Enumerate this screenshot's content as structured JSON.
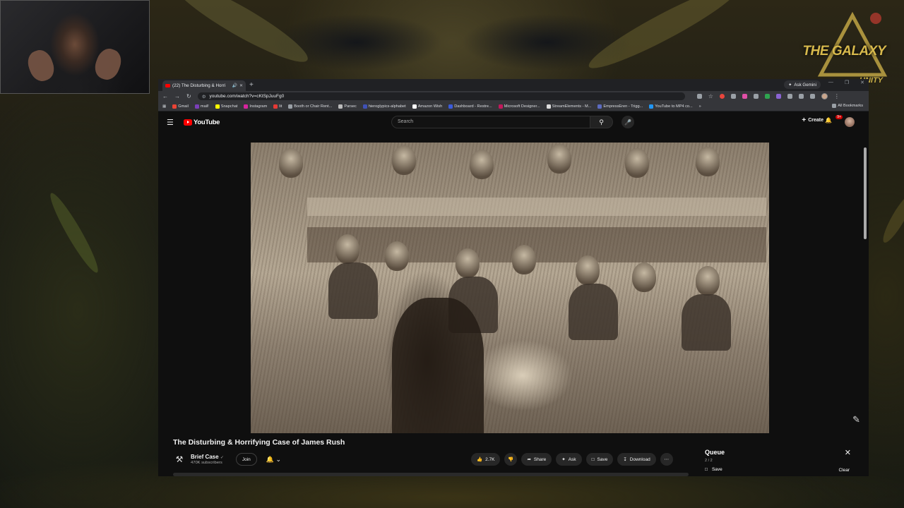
{
  "overlay": {
    "logo_text": "THE GALAXY",
    "logo_sub": "UNITY"
  },
  "browser": {
    "tab_title": "(22) The Disturbing & Horri",
    "gemini_label": "Ask Gemini",
    "url": "youtube.com/watch?v=cKtSpJuuFg0",
    "bookmarks": [
      "Gmail",
      "mail!",
      "Snapchat",
      "Instagram",
      "lit",
      "Booth or Chair Rent...",
      "Parsec",
      "hieroglypics-alphabet",
      "Amazon Wish",
      "Dashboard - Restre...",
      "Microsoft Designer...",
      "StreamElements - M...",
      "EmpressEren - Trigg...",
      "YouTube to MP4 co..."
    ],
    "all_bookmarks": "All Bookmarks"
  },
  "youtube": {
    "logo": "YouTube",
    "search_placeholder": "Search",
    "create_label": "Create",
    "notif_badge": "9+",
    "video_title": "The Disturbing & Horrifying Case of James Rush",
    "channel_name": "Brief Case",
    "subscribers": "470K subscribers",
    "join_label": "Join",
    "likes": "2.7K",
    "share_label": "Share",
    "ask_label": "Ask",
    "save_label": "Save",
    "download_label": "Download",
    "queue": {
      "title": "Queue",
      "count": "2 / 2",
      "save_label": "Save",
      "clear_label": "Clear"
    }
  }
}
